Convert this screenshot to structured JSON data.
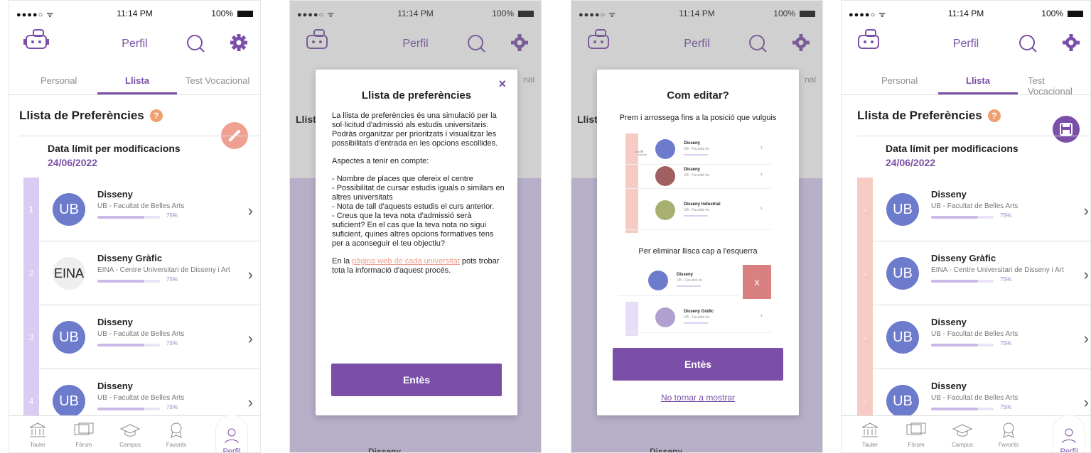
{
  "status": {
    "signal": "●●●●○ ᯤ",
    "time": "11:14 PM",
    "battery": "100%"
  },
  "header": {
    "title": "Perfil"
  },
  "tabs": [
    "Personal",
    "Llista",
    "Test Vocacional"
  ],
  "section": {
    "title": "Llista de Preferències",
    "help": "?"
  },
  "deadline": {
    "label": "Data límit per modificacions",
    "date": "24/06/2022"
  },
  "list": [
    {
      "num": "1",
      "avatar": "UB",
      "title": "Disseny",
      "sub": "UB - Facultat de Belles Arts",
      "pct_label": "75%",
      "pct": 0.75
    },
    {
      "num": "2",
      "avatar": "EINA",
      "title": "Disseny Gràfic",
      "sub": "EINA - Centre Universitari de Disseny i Art",
      "pct_label": "75%",
      "pct": 0.75
    },
    {
      "num": "3",
      "avatar": "UB",
      "title": "Disseny",
      "sub": "UB - Facultat de Belles Arts",
      "pct_label": "75%",
      "pct": 0.75
    },
    {
      "num": "4",
      "avatar": "UB",
      "title": "Disseny",
      "sub": "UB - Facultat de Belles Arts",
      "pct_label": "75%",
      "pct": 0.75
    }
  ],
  "edit_num": "-",
  "bottom_nav": [
    "Tauler",
    "Fòrum",
    "Campus",
    "Favorits",
    "Perfil"
  ],
  "modal_info": {
    "title": "Llista de preferències",
    "close": "×",
    "p1": "La llista de preferències és una simulació per la sol·licitud d'admissió als estudis universitaris. Podràs organitzar per prioritzats i visualitzar les possibilitats d'entrada en les opcions escollides.",
    "p2": "Aspectes a tenir en compte:",
    "p3": "- Nombre de places que ofereix el centre\n- Possibilitat de cursar estudis iguals o similars en altres universitats\n- Nota de tall d'aquests estudis el curs anterior.\n- Creus que la teva nota d'admissió serà suficient? En el cas que la teva nota no sigui suficient, quines altres opcions formatives tens per a aconseguir el teu objectiu?",
    "p4_pre": "En la ",
    "p4_link": "pàgina web de cada universitat",
    "p4_post": " pots trobar tota la informació d'aquest procés.",
    "button": "Entès",
    "bg_title": "Llist",
    "bg_tab": "nal",
    "bg_row": "Disseny"
  },
  "modal_edit": {
    "title": "Com editar?",
    "instr1": "Prem i arrossega fins a la posició que vulguis",
    "instr2": "Per eliminar llisca cap a l'esquerra",
    "ill_rows": [
      {
        "t": "Disseny",
        "s": "UB - Facultat de",
        "p": "75%"
      },
      {
        "t": "Disseny",
        "s": "UB - Facultat de",
        "p": "75%"
      },
      {
        "t": "Disseny Industrial",
        "s": "UB - Facultat de",
        "p": "75%"
      },
      {
        "t": "Disseny",
        "s": "UB - Facultat de",
        "p": "75%"
      },
      {
        "t": "Disseny Gràfic",
        "s": "UB - Facultat de",
        "p": "75%"
      }
    ],
    "delete_label": "x",
    "button": "Entès",
    "dont_show": "No tornar a mostrar"
  },
  "colors": {
    "accent": "#7b4fa8",
    "orange": "#f0a070",
    "lilac": "#d9ccf3",
    "pink": "#f5cbc4",
    "avatar": "#6c7bcc"
  }
}
